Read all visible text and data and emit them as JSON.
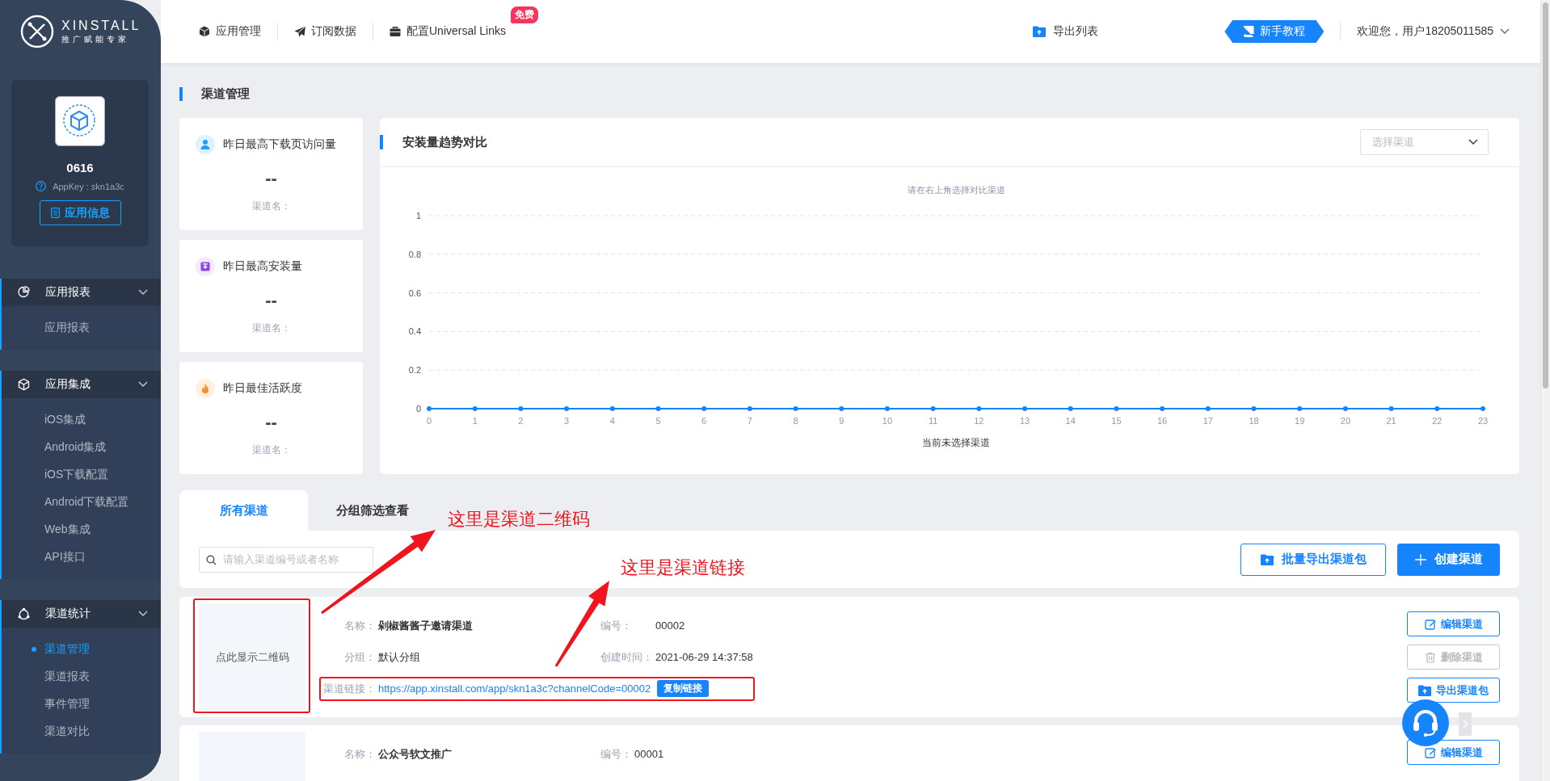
{
  "sidebar": {
    "logo": {
      "wordmark": "XINSTALL",
      "tagline": "推广赋能专家"
    },
    "app": {
      "name": "0616",
      "appkey": "AppKey : skn1a3c",
      "info_button": "应用信息"
    },
    "groups": [
      {
        "label": "应用报表",
        "kind": "report",
        "expanded": true,
        "items": [
          {
            "label": "应用报表",
            "selected": false
          }
        ]
      },
      {
        "label": "应用集成",
        "kind": "integration",
        "expanded": true,
        "items": [
          {
            "label": "iOS集成",
            "selected": false
          },
          {
            "label": "Android集成",
            "selected": false
          },
          {
            "label": "iOS下载配置",
            "selected": false
          },
          {
            "label": "Android下载配置",
            "selected": false
          },
          {
            "label": "Web集成",
            "selected": false
          },
          {
            "label": "API接口",
            "selected": false
          }
        ]
      },
      {
        "label": "渠道统计",
        "kind": "channel",
        "expanded": true,
        "items": [
          {
            "label": "渠道管理",
            "selected": true
          },
          {
            "label": "渠道报表",
            "selected": false
          },
          {
            "label": "事件管理",
            "selected": false
          },
          {
            "label": "渠道对比",
            "selected": false
          }
        ]
      }
    ]
  },
  "header": {
    "nav": [
      {
        "label": "应用管理",
        "kind": "cube"
      },
      {
        "label": "订阅数据",
        "kind": "plane"
      },
      {
        "label": "配置Universal Links",
        "kind": "briefcase",
        "badge": "免费"
      }
    ],
    "export_list": "导出列表",
    "tutorial_button": "新手教程",
    "user_menu": "欢迎您，用户18205011585"
  },
  "page_title": "渠道管理",
  "stats": [
    {
      "kind": "visits",
      "title": "昨日最高下载页访问量",
      "value": "--",
      "channel_label": "渠道名："
    },
    {
      "kind": "installs",
      "title": "昨日最高安装量",
      "value": "--",
      "channel_label": "渠道名："
    },
    {
      "kind": "activity",
      "title": "昨日最佳活跃度",
      "value": "--",
      "channel_label": "渠道名："
    }
  ],
  "trend": {
    "title": "安装量趋势对比",
    "select_placeholder": "选择渠道",
    "chart_data": {
      "type": "line",
      "title": "请在右上角选择对比渠道",
      "xlabel": "当前未选择渠道",
      "x": [
        0,
        1,
        2,
        3,
        4,
        5,
        6,
        7,
        8,
        9,
        10,
        11,
        12,
        13,
        14,
        15,
        16,
        17,
        18,
        19,
        20,
        21,
        22,
        23
      ],
      "series": [
        {
          "color": "#1684fc",
          "marker": "circle",
          "values": [
            0,
            0,
            0,
            0,
            0,
            0,
            0,
            0,
            0,
            0,
            0,
            0,
            0,
            0,
            0,
            0,
            0,
            0,
            0,
            0,
            0,
            0,
            0,
            0
          ]
        }
      ],
      "xlim": [
        0,
        23
      ],
      "ylim": [
        0,
        1
      ],
      "grid": true,
      "yticks": [
        0,
        0.2,
        0.4,
        0.6,
        0.8,
        1
      ],
      "xticks": [
        0,
        1,
        2,
        3,
        4,
        5,
        6,
        7,
        8,
        9,
        10,
        11,
        12,
        13,
        14,
        15,
        16,
        17,
        18,
        19,
        20,
        21,
        22,
        23
      ]
    }
  },
  "tabs": [
    {
      "label": "所有渠道",
      "selected": true
    },
    {
      "label": "分组筛选查看",
      "selected": false
    }
  ],
  "toolbar": {
    "search_placeholder": "请输入渠道编号或者名称",
    "buttons": [
      {
        "label": "批量导出渠道包",
        "kind": "outline"
      },
      {
        "label": "创建渠道",
        "kind": "primary"
      }
    ]
  },
  "channels": [
    {
      "qr_hint": "点此显示二维码",
      "name": {
        "label": "名称：",
        "value": "剁椒酱酱子邀请渠道"
      },
      "code": {
        "label": "编号：",
        "value": "00002"
      },
      "group": {
        "label": "分组：",
        "value": "默认分组"
      },
      "created": {
        "label": "创建时间：",
        "value": "2021-06-29 14:37:58"
      },
      "link": {
        "label": "渠道链接：",
        "value": "https://app.xinstall.com/app/skn1a3c?channelCode=00002",
        "copy_button": "复制链接"
      },
      "actions": [
        {
          "kind": "edit",
          "label": "编辑渠道",
          "disabled": false
        },
        {
          "kind": "delete",
          "label": "删除渠道",
          "disabled": true
        },
        {
          "kind": "export",
          "label": "导出渠道包",
          "disabled": false
        }
      ]
    },
    {
      "name": {
        "label": "名称：",
        "value": "公众号软文推广"
      },
      "code": {
        "label": "编号：",
        "value": "00001"
      },
      "actions": [
        {
          "kind": "edit",
          "label": "编辑渠道",
          "disabled": false
        }
      ]
    }
  ],
  "annotations": [
    {
      "text": "这里是渠道二维码"
    },
    {
      "text": "这里是渠道链接"
    }
  ]
}
